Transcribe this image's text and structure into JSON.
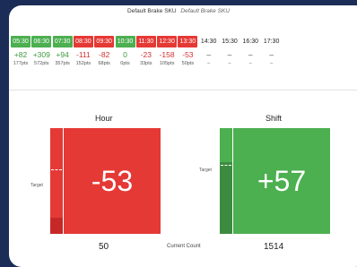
{
  "header": {
    "title": "Default Brake SKU",
    "subtitle": "Default Brake SKU"
  },
  "slots": [
    {
      "time": "05:30",
      "delta": "+82",
      "pts": "177pts",
      "status": "green"
    },
    {
      "time": "06:30",
      "delta": "+309",
      "pts": "572pts",
      "status": "green"
    },
    {
      "time": "07:30",
      "delta": "+94",
      "pts": "357pts",
      "status": "green"
    },
    {
      "time": "08:30",
      "delta": "-111",
      "pts": "152pts",
      "status": "red"
    },
    {
      "time": "09:30",
      "delta": "-82",
      "pts": "68pts",
      "status": "red"
    },
    {
      "time": "10:30",
      "delta": "0",
      "pts": "0pts",
      "status": "green"
    },
    {
      "time": "11:30",
      "delta": "-23",
      "pts": "33pts",
      "status": "red"
    },
    {
      "time": "12:30",
      "delta": "-158",
      "pts": "105pts",
      "status": "red"
    },
    {
      "time": "13:30",
      "delta": "-53",
      "pts": "50pts",
      "status": "red"
    },
    {
      "time": "14:30",
      "delta": "–",
      "pts": "–",
      "status": "none"
    },
    {
      "time": "15:30",
      "delta": "–",
      "pts": "–",
      "status": "none"
    },
    {
      "time": "16:30",
      "delta": "–",
      "pts": "–",
      "status": "none"
    },
    {
      "time": "17:30",
      "delta": "–",
      "pts": "–",
      "status": "none"
    }
  ],
  "hour": {
    "title": "Hour",
    "value": "-53",
    "count": "50",
    "target_label": "Target",
    "progress_fraction": 0.15,
    "target_fraction": 0.6,
    "color": "#e53935",
    "fill_color": "#c62828"
  },
  "shift": {
    "title": "Shift",
    "value": "+57",
    "count": "1514",
    "target_label": "Target",
    "progress_fraction": 0.68,
    "target_fraction": 0.64,
    "color": "#4caf50",
    "fill_color": "#3d8b40"
  },
  "current_count_label": "Current Count"
}
